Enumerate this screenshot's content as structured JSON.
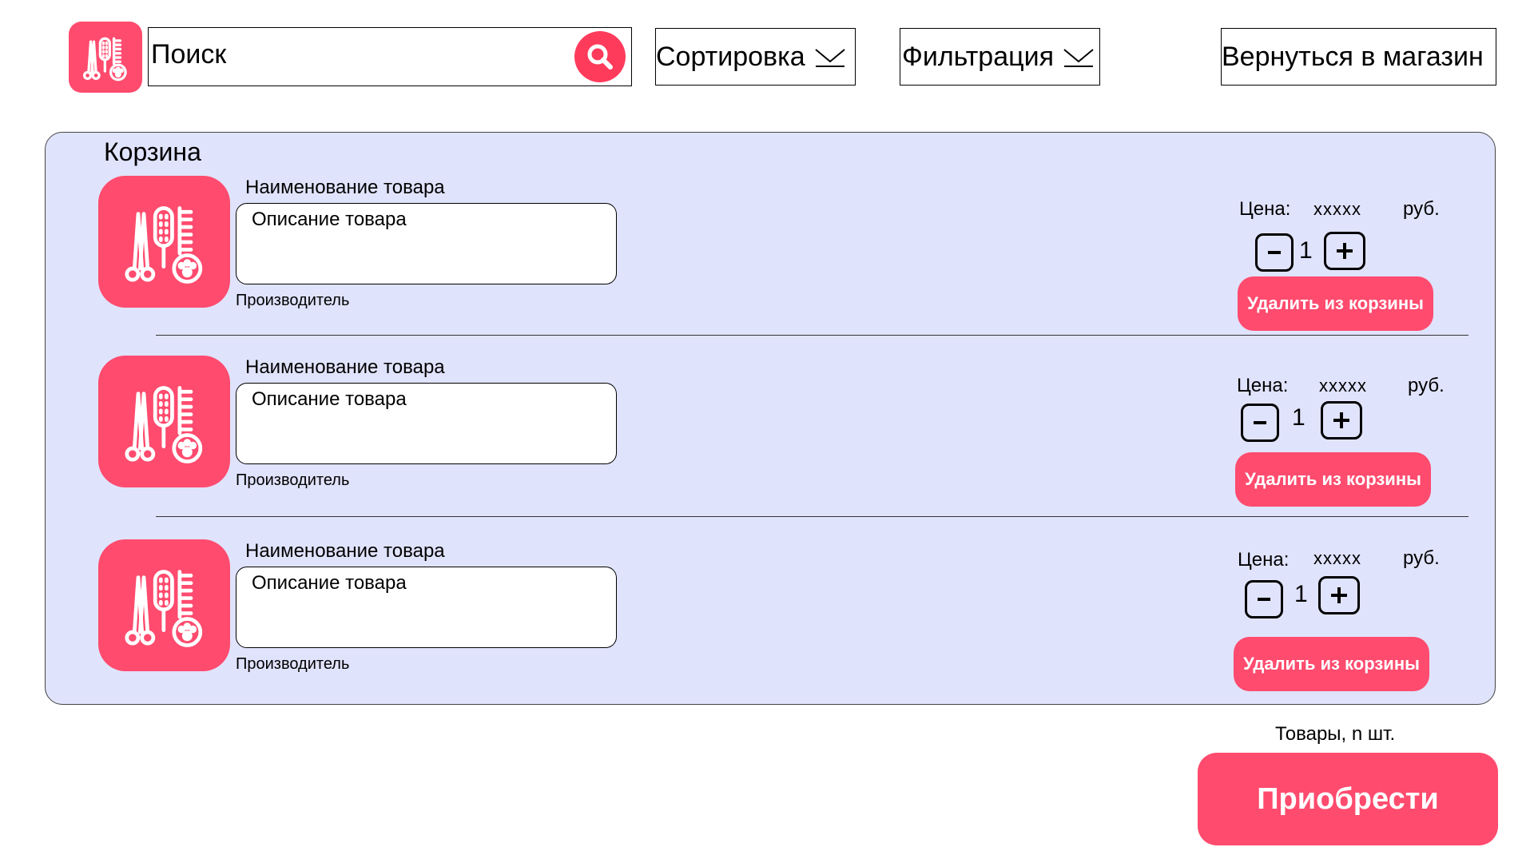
{
  "colors": {
    "accent": "#ff4b6e",
    "search_button": "#ff3b5c",
    "cart_background": "#e0e3fc"
  },
  "header": {
    "logo_icon": "grooming-tools-icon",
    "search": {
      "text": "Поиск",
      "icon": "search-icon"
    },
    "sort_label": "Сортировка",
    "filter_label": "Фильтрация",
    "back_label": "Вернуться в магазин"
  },
  "cart": {
    "title": "Корзина",
    "items": [
      {
        "name": "Наименование товара",
        "description": "Описание товара",
        "maker": "Производитель",
        "price_label": "Цена:",
        "price": "xxxxx",
        "currency": "руб.",
        "quantity": "1",
        "delete_label": "Удалить из корзины"
      },
      {
        "name": "Наименование товара",
        "description": "Описание товара",
        "maker": "Производитель",
        "price_label": "Цена:",
        "price": "xxxxx",
        "currency": "руб.",
        "quantity": "1",
        "delete_label": "Удалить из корзины"
      },
      {
        "name": "Наименование товара",
        "description": "Описание товара",
        "maker": "Производитель",
        "price_label": "Цена:",
        "price": "xxxxx",
        "currency": "руб.",
        "quantity": "1",
        "delete_label": "Удалить из корзины"
      }
    ]
  },
  "footer": {
    "items_count": "Товары, n шт.",
    "buy_label": "Приобрести"
  }
}
